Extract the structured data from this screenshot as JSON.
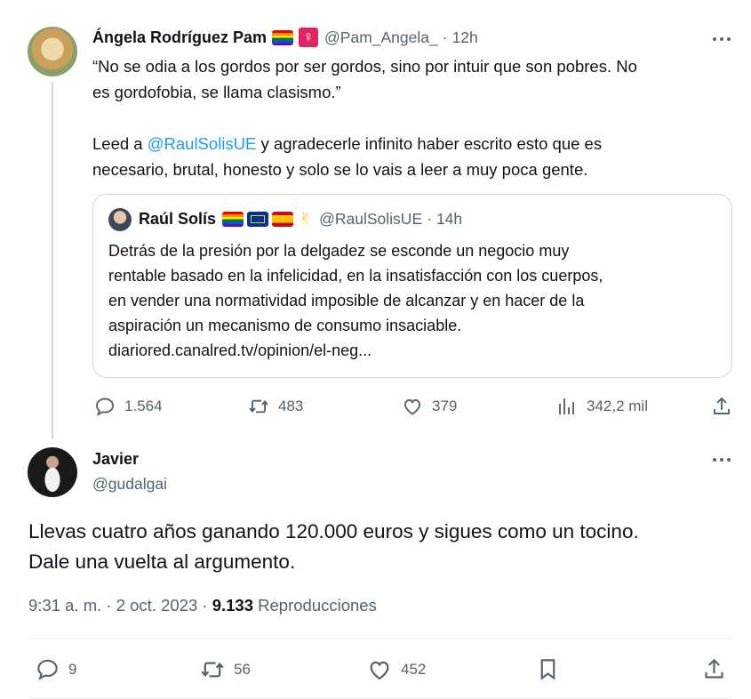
{
  "tweet1": {
    "author_name": "Ángela Rodríguez Pam",
    "symbol_female": "♀",
    "handle": "@Pam_Angela_",
    "sep": "·",
    "time": "12h",
    "text_line1": "“No se odia a los gordos por ser gordos, sino por intuir que son pobres. No",
    "text_line2": "es gordofobia, se llama clasismo.”",
    "text_p2_prefix": "Leed a ",
    "text_p2_mention": "@RaulSolisUE",
    "text_p2_suffix": " y agradecerle infinito haber escrito esto que es",
    "text_p2_line2": "necesario, brutal, honesto y solo se lo vais a leer a muy poca gente.",
    "metrics": {
      "replies": "1.564",
      "retweets": "483",
      "likes": "379",
      "views": "342,2 mil"
    }
  },
  "quote": {
    "author_name": "Raúl Solís",
    "victory": "✌",
    "handle": "@RaulSolisUE",
    "sep": "·",
    "time": "14h",
    "lines": [
      "Detrás de la presión por la delgadez se esconde un negocio muy",
      "rentable basado en la infelicidad, en la insatisfacción con los cuerpos,",
      "en vender una normatividad imposible de alcanzar y en hacer de la",
      "aspiración un mecanismo de consumo insaciable.",
      "diariored.canalred.tv/opinion/el-neg..."
    ]
  },
  "tweet2": {
    "author_name": "Javier",
    "handle": "@gudalgai",
    "text_line1": "Llevas cuatro años ganando 120.000 euros y sigues como un tocino.",
    "text_line2": "Dale una vuelta al argumento.",
    "timestamp": "9:31 a. m. · 2 oct. 2023 ·",
    "views_count": "9.133",
    "views_label": "Reproducciones",
    "metrics": {
      "replies": "9",
      "retweets": "56",
      "likes": "452"
    }
  },
  "colors": {
    "link": "#1d9bf0",
    "muted": "#536471",
    "border": "#cfd9de"
  }
}
